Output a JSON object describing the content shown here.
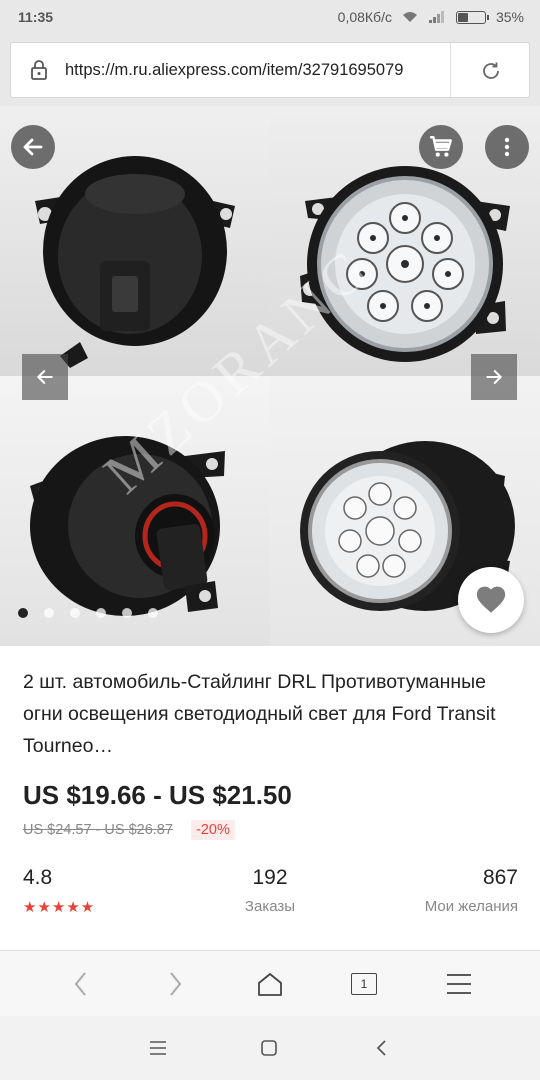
{
  "status_bar": {
    "time": "11:35",
    "network_speed": "0,08Кб/с",
    "battery": "35%"
  },
  "browser": {
    "url": "https://m.ru.aliexpress.com/item/32791695079",
    "tab_count": "1"
  },
  "gallery": {
    "watermark": "MZORANG",
    "slide_count": 6,
    "active_slide": 1
  },
  "product": {
    "title": "2 шт. автомобиль-Стайлинг DRL Противотуманные огни освещения светодиодный свет для Ford Transit Tourneo…",
    "price": "US $19.66 - US $21.50",
    "old_price": "US $24.57 - US $26.87",
    "discount": "-20%",
    "rating": "4.8",
    "rating_stars": "★★★★★",
    "orders_count": "192",
    "orders_label": "Заказы",
    "wishlist_count": "867",
    "wishlist_label": "Мои желания"
  },
  "colors": {
    "accent_red": "#e8413a",
    "text_dark": "#222222",
    "text_gray": "#888888"
  }
}
